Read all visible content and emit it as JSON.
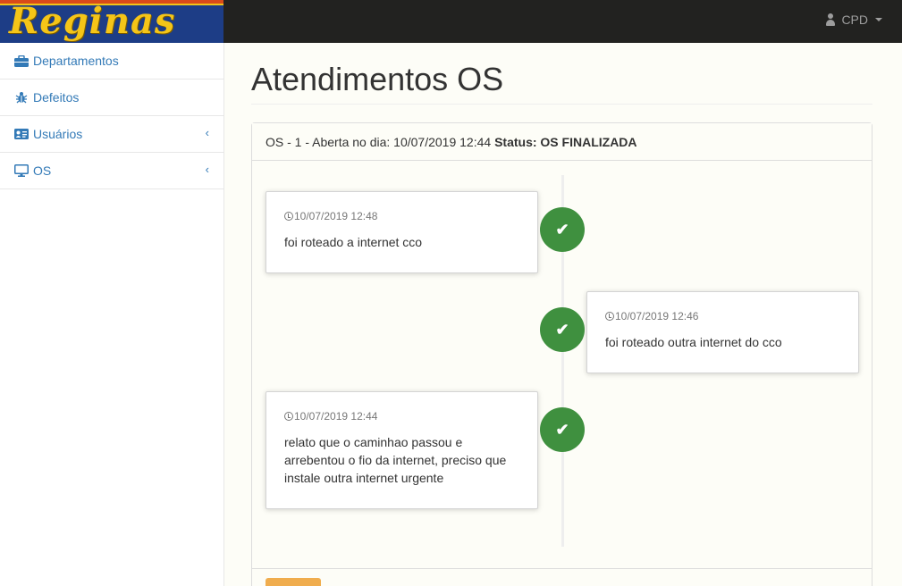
{
  "brand": {
    "logo_text": "Reginas"
  },
  "header": {
    "user_label": "CPD"
  },
  "sidebar": {
    "items": [
      {
        "label": "Departamentos",
        "icon": "briefcase-icon",
        "has_submenu": false
      },
      {
        "label": "Defeitos",
        "icon": "bug-icon",
        "has_submenu": false
      },
      {
        "label": "Usuários",
        "icon": "id-card-icon",
        "has_submenu": true
      },
      {
        "label": "OS",
        "icon": "monitor-icon",
        "has_submenu": true
      }
    ]
  },
  "main": {
    "title": "Atendimentos OS",
    "panel": {
      "heading_prefix": "OS - 1 - Aberta no dia: 10/07/2019 12:44",
      "status_label": "Status: OS FINALIZADA"
    },
    "timeline": [
      {
        "time": "10/07/2019 12:48",
        "text": "foi roteado a internet cco",
        "side": "left",
        "status_icon": "check-icon"
      },
      {
        "time": "10/07/2019 12:46",
        "text": "foi roteado outra internet do cco",
        "side": "right",
        "status_icon": "check-icon"
      },
      {
        "time": "10/07/2019 12:44",
        "text": "relato que o caminhao passou e arrebentou o fio da internet, preciso que instale outra internet urgente",
        "side": "left",
        "status_icon": "check-icon"
      }
    ]
  },
  "colors": {
    "accent": "#337ab7",
    "success": "#3f903f",
    "warning": "#f0ad4e",
    "topbar": "#222220",
    "logo_bg": "#1d3d86",
    "logo_text": "#f5c518"
  }
}
